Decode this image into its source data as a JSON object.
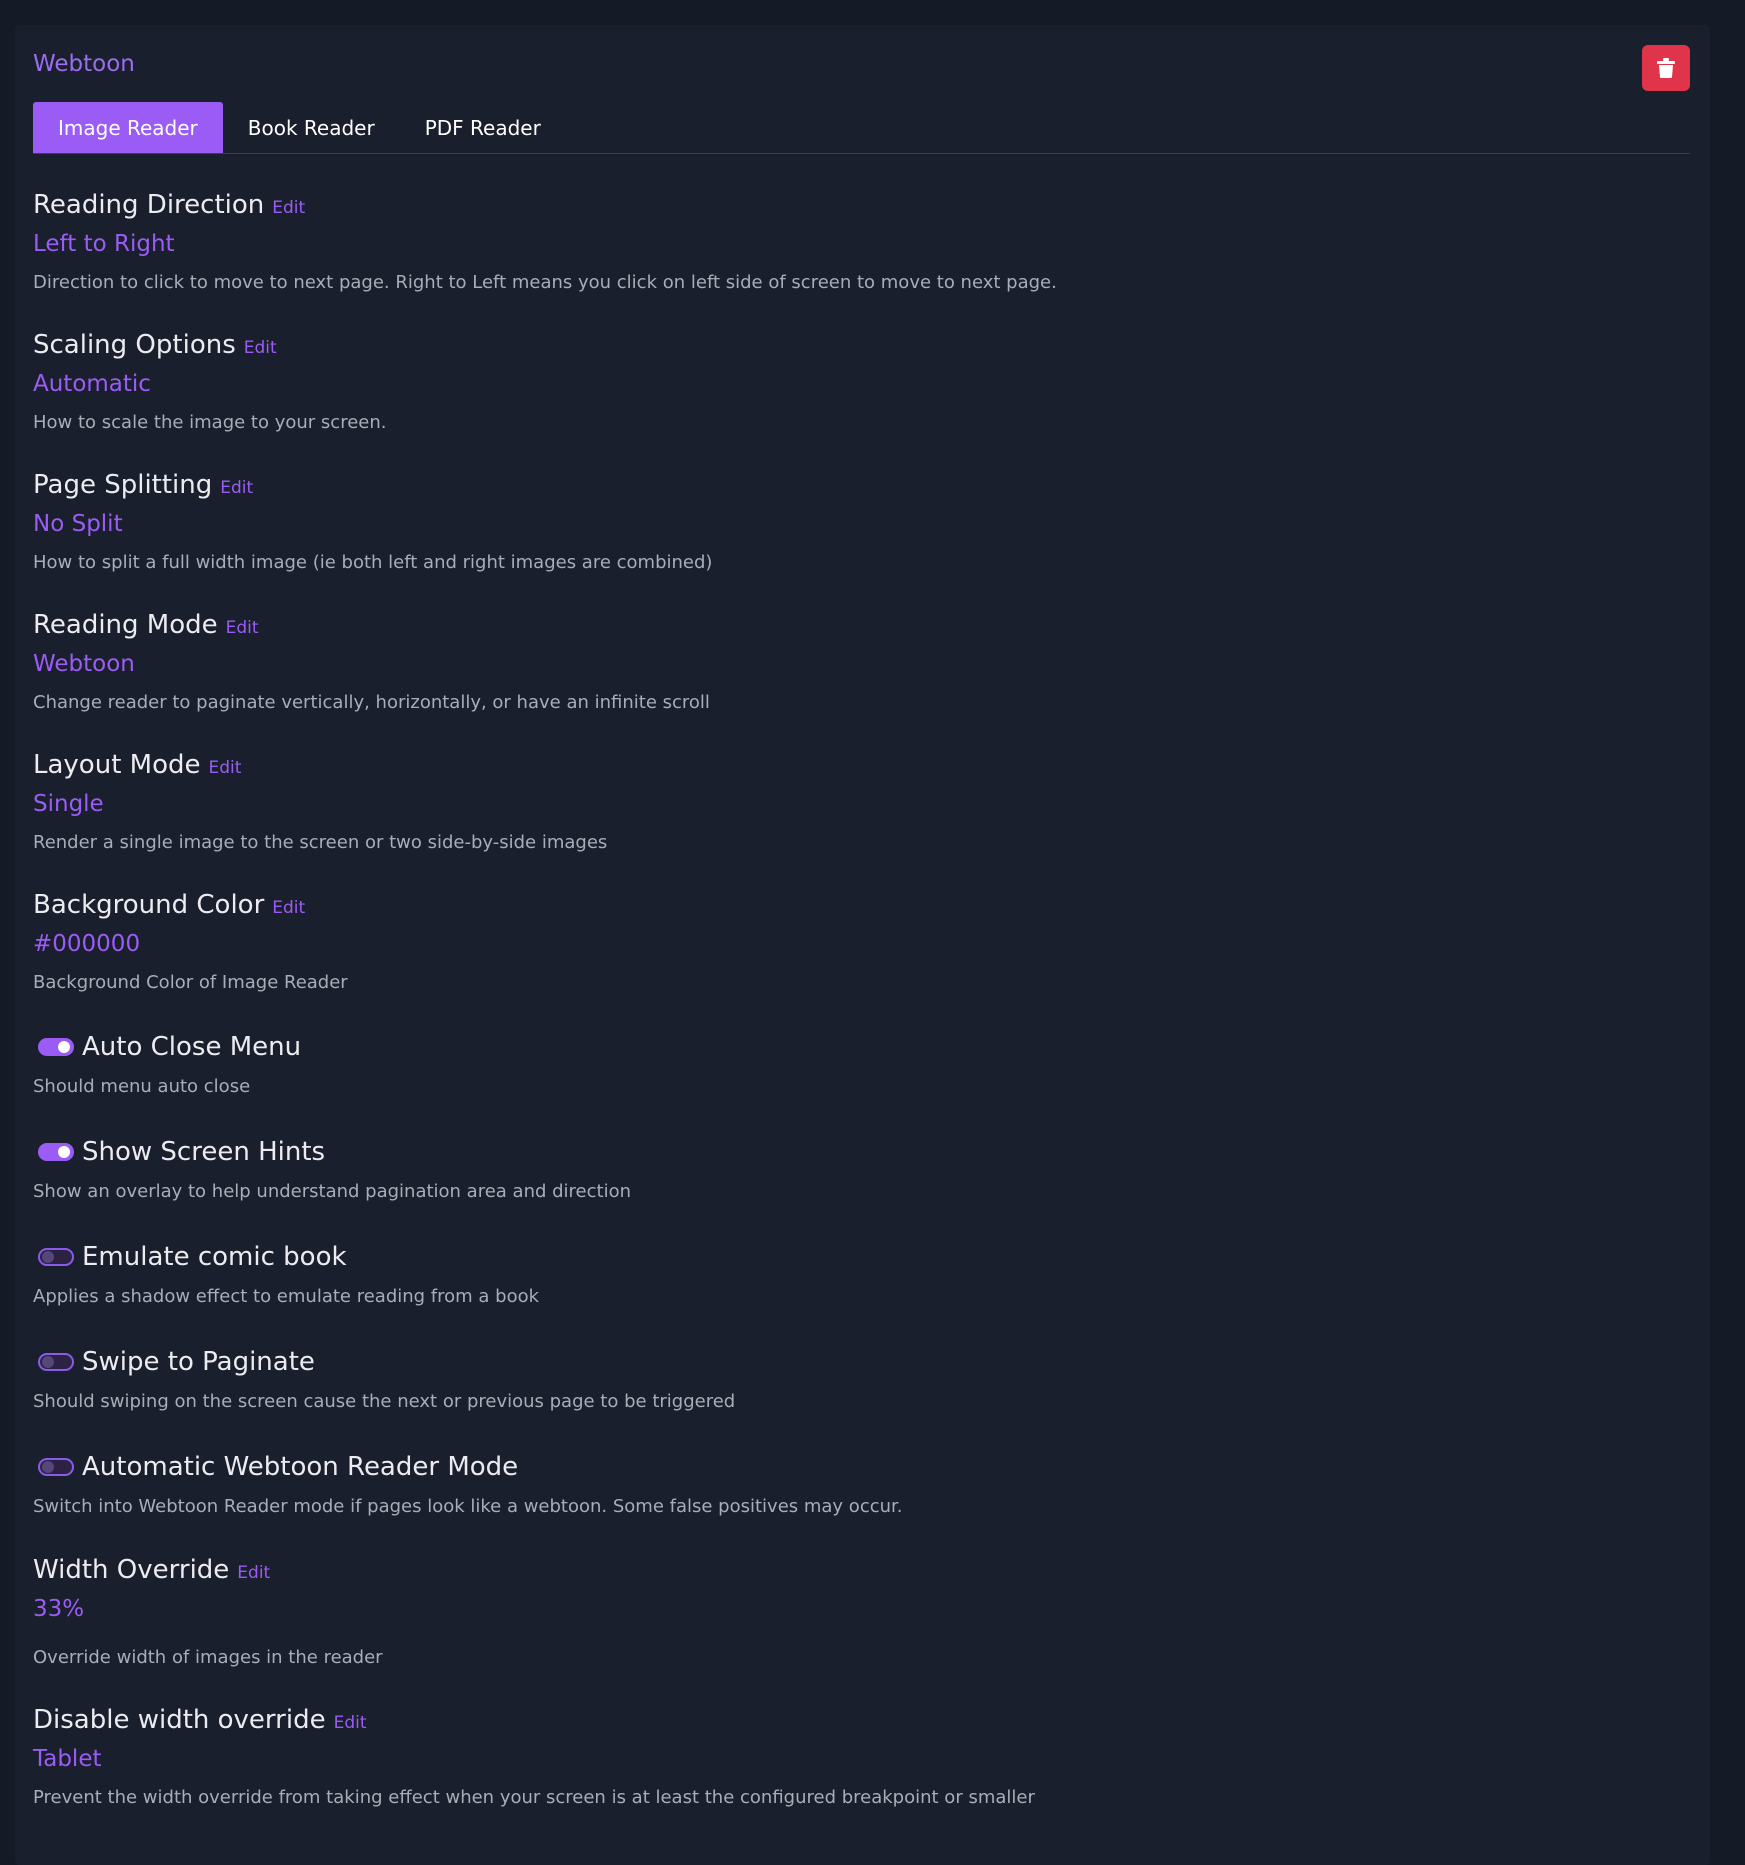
{
  "header": {
    "profile_name": "Webtoon",
    "delete_icon": "trash-icon"
  },
  "tabs": [
    {
      "label": "Image Reader",
      "active": true
    },
    {
      "label": "Book Reader",
      "active": false
    },
    {
      "label": "PDF Reader",
      "active": false
    }
  ],
  "edit_label": "Edit",
  "settings": {
    "reading_direction": {
      "title": "Reading Direction",
      "value": "Left to Right",
      "description": "Direction to click to move to next page. Right to Left means you click on left side of screen to move to next page."
    },
    "scaling_options": {
      "title": "Scaling Options",
      "value": "Automatic",
      "description": "How to scale the image to your screen."
    },
    "page_splitting": {
      "title": "Page Splitting",
      "value": "No Split",
      "description": "How to split a full width image (ie both left and right images are combined)"
    },
    "reading_mode": {
      "title": "Reading Mode",
      "value": "Webtoon",
      "description": "Change reader to paginate vertically, horizontally, or have an infinite scroll"
    },
    "layout_mode": {
      "title": "Layout Mode",
      "value": "Single",
      "description": "Render a single image to the screen or two side-by-side images"
    },
    "background_color": {
      "title": "Background Color",
      "value": "#000000",
      "description": "Background Color of Image Reader"
    },
    "auto_close_menu": {
      "title": "Auto Close Menu",
      "enabled": true,
      "description": "Should menu auto close"
    },
    "show_screen_hints": {
      "title": "Show Screen Hints",
      "enabled": true,
      "description": "Show an overlay to help understand pagination area and direction"
    },
    "emulate_comic_book": {
      "title": "Emulate comic book",
      "enabled": false,
      "description": "Applies a shadow effect to emulate reading from a book"
    },
    "swipe_to_paginate": {
      "title": "Swipe to Paginate",
      "enabled": false,
      "description": "Should swiping on the screen cause the next or previous page to be triggered"
    },
    "auto_webtoon_mode": {
      "title": "Automatic Webtoon Reader Mode",
      "enabled": false,
      "description": "Switch into Webtoon Reader mode if pages look like a webtoon. Some false positives may occur."
    },
    "width_override": {
      "title": "Width Override",
      "value": "33%",
      "description": "Override width of images in the reader"
    },
    "disable_width_override": {
      "title": "Disable width override",
      "value": "Tablet",
      "description": "Prevent the width override from taking effect when your screen is at least the configured breakpoint or smaller"
    }
  },
  "colors": {
    "accent": "#9b5cf5",
    "delete": "#e0344a",
    "background": "#141a26",
    "card": "#1a1f2d"
  }
}
